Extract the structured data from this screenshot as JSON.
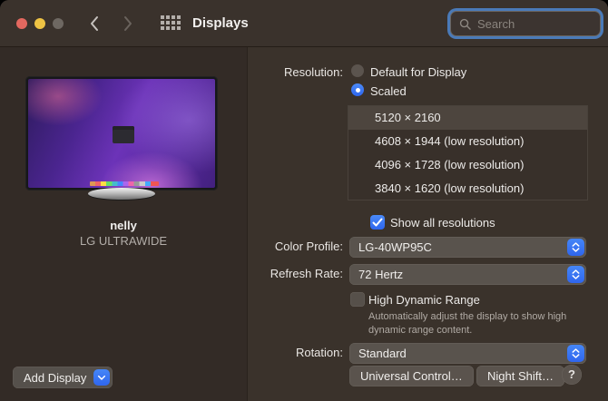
{
  "titlebar": {
    "title": "Displays",
    "search_placeholder": "Search"
  },
  "sidebar": {
    "display_name": "nelly",
    "display_model": "LG ULTRAWIDE",
    "add_display_label": "Add Display"
  },
  "main": {
    "resolution": {
      "label": "Resolution:",
      "radio_default": "Default for Display",
      "radio_scaled": "Scaled",
      "radio_selected": "Scaled",
      "list": [
        {
          "label": "5120 × 2160",
          "selected": true
        },
        {
          "label": "4608 × 1944 (low resolution)",
          "selected": false
        },
        {
          "label": "4096 × 1728 (low resolution)",
          "selected": false
        },
        {
          "label": "3840 × 1620 (low resolution)",
          "selected": false
        }
      ],
      "show_all_label": "Show all resolutions",
      "show_all_checked": true
    },
    "color_profile": {
      "label": "Color Profile:",
      "value": "LG-40WP95C"
    },
    "refresh_rate": {
      "label": "Refresh Rate:",
      "value": "72 Hertz"
    },
    "hdr": {
      "label": "High Dynamic Range",
      "checked": false,
      "description": "Automatically adjust the display to show high dynamic range content."
    },
    "rotation": {
      "label": "Rotation:",
      "value": "Standard"
    },
    "buttons": {
      "universal_control": "Universal Control…",
      "night_shift": "Night Shift…",
      "help": "?"
    }
  },
  "colors": {
    "accent_blue": "#3674f5",
    "traffic_red": "#e3685f",
    "traffic_yellow": "#eec344",
    "traffic_disabled": "#6e6862",
    "window_bg": "#3a322b",
    "sidebar_bg": "#332b26"
  }
}
